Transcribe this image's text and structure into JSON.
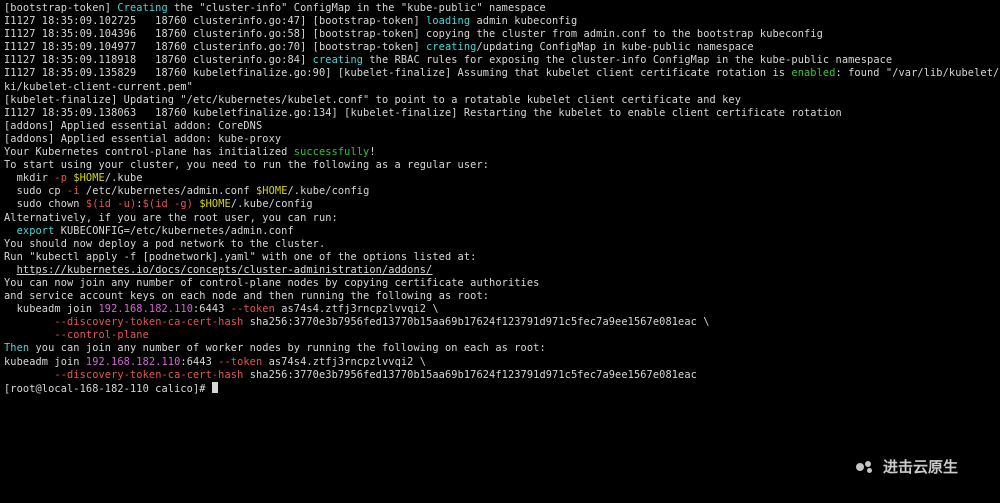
{
  "lines": [
    [
      {
        "t": "[bootstrap-token] ",
        "c": "c-white"
      },
      {
        "t": "Creating",
        "c": "c-cyan"
      },
      {
        "t": " the \"cluster-info\" ConfigMap in the \"kube-public\" namespace",
        "c": "c-white"
      }
    ],
    [
      {
        "t": "I1127 18:35:09.102725   18760 clusterinfo.go:47] [bootstrap-token] ",
        "c": "c-white"
      },
      {
        "t": "loading",
        "c": "c-cyan"
      },
      {
        "t": " admin kubeconfig",
        "c": "c-white"
      }
    ],
    [
      {
        "t": "I1127 18:35:09.104396   18760 clusterinfo.go:58] [bootstrap-token] copying the cluster from admin.conf to the bootstrap kubeconfig",
        "c": "c-white"
      }
    ],
    [
      {
        "t": "I1127 18:35:09.104977   18760 clusterinfo.go:70] [bootstrap-token] ",
        "c": "c-white"
      },
      {
        "t": "creating",
        "c": "c-cyan"
      },
      {
        "t": "/updating ConfigMap in kube-public namespace",
        "c": "c-white"
      }
    ],
    [
      {
        "t": "I1127 18:35:09.118918   18760 clusterinfo.go:84] ",
        "c": "c-white"
      },
      {
        "t": "creating",
        "c": "c-cyan"
      },
      {
        "t": " the RBAC rules for exposing the cluster-info ConfigMap in the kube-public namespace",
        "c": "c-white"
      }
    ],
    [
      {
        "t": "I1127 18:35:09.135829   18760 kubeletfinalize.go:90] [kubelet-finalize] Assuming that kubelet client certificate rotation is ",
        "c": "c-white"
      },
      {
        "t": "enabled",
        "c": "c-green"
      },
      {
        "t": ": found \"/var/lib/kubelet/p",
        "c": "c-white"
      }
    ],
    [
      {
        "t": "ki/kubelet-client-current.pem\"",
        "c": "c-white"
      }
    ],
    [
      {
        "t": "[kubelet-finalize] Updating \"/etc/kubernetes/kubelet.conf\" to point to a rotatable kubelet client certificate and key",
        "c": "c-white"
      }
    ],
    [
      {
        "t": "I1127 18:35:09.138063   18760 kubeletfinalize.go:134] [kubelet-finalize] Restarting the kubelet to enable client certificate rotation",
        "c": "c-white"
      }
    ],
    [
      {
        "t": "[addons] Applied essential addon: CoreDNS",
        "c": "c-white"
      }
    ],
    [
      {
        "t": "[addons] Applied essential addon: kube-proxy",
        "c": "c-white"
      }
    ],
    [
      {
        "t": "",
        "c": "c-white"
      }
    ],
    [
      {
        "t": "Your Kubernetes control-plane has initialized ",
        "c": "c-white"
      },
      {
        "t": "successfully",
        "c": "c-green"
      },
      {
        "t": "!",
        "c": "c-white"
      }
    ],
    [
      {
        "t": "",
        "c": "c-white"
      }
    ],
    [
      {
        "t": "To start using your cluster, you need to run the following as a regular user:",
        "c": "c-white"
      }
    ],
    [
      {
        "t": "",
        "c": "c-white"
      }
    ],
    [
      {
        "t": "  mkdir ",
        "c": "c-white"
      },
      {
        "t": "-p",
        "c": "c-red"
      },
      {
        "t": " ",
        "c": "c-white"
      },
      {
        "t": "$HOME",
        "c": "c-yellow"
      },
      {
        "t": "/.kube",
        "c": "c-white"
      }
    ],
    [
      {
        "t": "  sudo cp ",
        "c": "c-white"
      },
      {
        "t": "-i",
        "c": "c-red"
      },
      {
        "t": " /etc/kubernetes/admin.conf ",
        "c": "c-white"
      },
      {
        "t": "$HOME",
        "c": "c-yellow"
      },
      {
        "t": "/.kube/config",
        "c": "c-white"
      }
    ],
    [
      {
        "t": "  sudo chown ",
        "c": "c-white"
      },
      {
        "t": "$(id -u)",
        "c": "c-red"
      },
      {
        "t": ":",
        "c": "c-white"
      },
      {
        "t": "$(id -g)",
        "c": "c-red"
      },
      {
        "t": " ",
        "c": "c-white"
      },
      {
        "t": "$HOME",
        "c": "c-yellow"
      },
      {
        "t": "/.kube/config",
        "c": "c-white"
      }
    ],
    [
      {
        "t": "",
        "c": "c-white"
      }
    ],
    [
      {
        "t": "Alternatively, if you are the root user, you can run:",
        "c": "c-white"
      }
    ],
    [
      {
        "t": "",
        "c": "c-white"
      }
    ],
    [
      {
        "t": "  ",
        "c": "c-white"
      },
      {
        "t": "export",
        "c": "c-cyan"
      },
      {
        "t": " KUBECONFIG=/etc/kubernetes/admin.conf",
        "c": "c-white"
      }
    ],
    [
      {
        "t": "",
        "c": "c-white"
      }
    ],
    [
      {
        "t": "You should now deploy a pod network to the cluster.",
        "c": "c-white"
      }
    ],
    [
      {
        "t": "Run \"kubectl apply -f [podnetwork].yaml\" with one of the options listed at:",
        "c": "c-white"
      }
    ],
    [
      {
        "t": "  ",
        "c": "c-white"
      },
      {
        "t": "https://kubernetes.io/docs/concepts/cluster-administration/addons/",
        "c": "c-white",
        "u": true
      }
    ],
    [
      {
        "t": "",
        "c": "c-white"
      }
    ],
    [
      {
        "t": "You can now join any number of control-plane nodes by copying certificate authorities",
        "c": "c-white"
      }
    ],
    [
      {
        "t": "and service account keys on each node and then running the following as root:",
        "c": "c-white"
      }
    ],
    [
      {
        "t": "",
        "c": "c-white"
      }
    ],
    [
      {
        "t": "  kubeadm join ",
        "c": "c-white"
      },
      {
        "t": "192.168.182.110",
        "c": "c-mag"
      },
      {
        "t": ":6443 ",
        "c": "c-white"
      },
      {
        "t": "--token",
        "c": "c-red"
      },
      {
        "t": " as74s4.ztfj3rncpzlvvqi2 \\",
        "c": "c-white"
      }
    ],
    [
      {
        "t": "        ",
        "c": "c-white"
      },
      {
        "t": "--discovery-token-ca-cert-hash",
        "c": "c-red"
      },
      {
        "t": " sha256:3770e3b7956fed13770b15aa69b17624f123791d971c5fec7a9ee1567e081eac \\",
        "c": "c-white"
      }
    ],
    [
      {
        "t": "        ",
        "c": "c-white"
      },
      {
        "t": "--control-plane",
        "c": "c-red"
      }
    ],
    [
      {
        "t": "",
        "c": "c-white"
      }
    ],
    [
      {
        "t": "Then",
        "c": "c-cyan"
      },
      {
        "t": " you can join any number of worker nodes by running the following on each as root:",
        "c": "c-white"
      }
    ],
    [
      {
        "t": "",
        "c": "c-white"
      }
    ],
    [
      {
        "t": "kubeadm join ",
        "c": "c-white"
      },
      {
        "t": "192.168.182.110",
        "c": "c-mag"
      },
      {
        "t": ":6443 ",
        "c": "c-white"
      },
      {
        "t": "--token",
        "c": "c-red"
      },
      {
        "t": " as74s4.ztfj3rncpzlvvqi2 \\",
        "c": "c-white"
      }
    ],
    [
      {
        "t": "        ",
        "c": "c-white"
      },
      {
        "t": "--discovery-token-ca-cert-hash",
        "c": "c-red"
      },
      {
        "t": " sha256:3770e3b7956fed13770b15aa69b17624f123791d971c5fec7a9ee1567e081eac",
        "c": "c-white"
      }
    ]
  ],
  "prompt": {
    "user_host": "[root@local-168-182-110 calico]#",
    "cursor": true
  },
  "watermark": "进击云原生"
}
